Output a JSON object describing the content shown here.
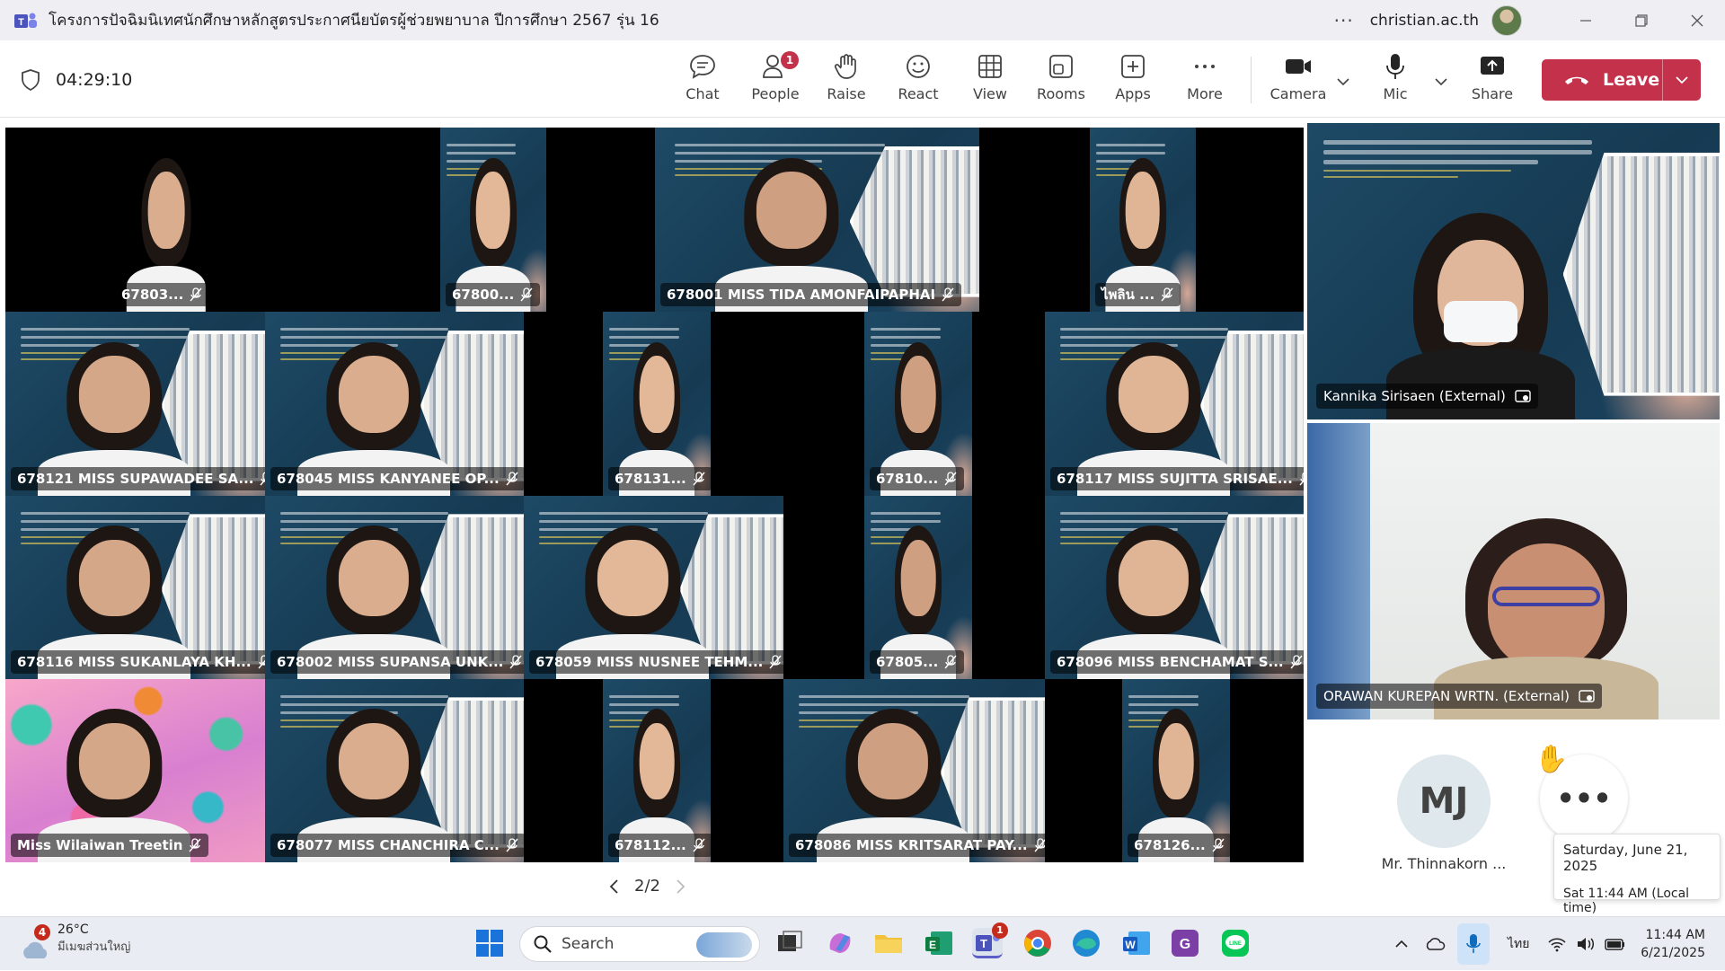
{
  "window": {
    "title": "โครงการปัจฉิมนิเทศนักศึกษาหลักสูตรประกาศนียบัตรผู้ช่วยพยาบาล ปีการศึกษา 2567 รุ่น 16",
    "account": "christian.ac.th",
    "more_glyph": "···"
  },
  "toolbar": {
    "timer": "04:29:10",
    "chat": "Chat",
    "people": "People",
    "people_badge": "1",
    "raise": "Raise",
    "react": "React",
    "view": "View",
    "rooms": "Rooms",
    "apps": "Apps",
    "more": "More",
    "camera": "Camera",
    "mic": "Mic",
    "share": "Share",
    "leave": "Leave"
  },
  "tiles": [
    {
      "name": "67803...",
      "bg": "dark"
    },
    {
      "name": "67800...",
      "bg": "slide"
    },
    {
      "name": "678001 MISS TIDA AMONFAIPAPHAI",
      "bg": "slide"
    },
    {
      "name": "ไพลิน ...",
      "bg": "slide"
    },
    {
      "name": "678121 MISS SUPAWADEE SA...",
      "bg": "slide"
    },
    {
      "name": "678045 MISS KANYANEE OP...",
      "bg": "slide"
    },
    {
      "name": "678131...",
      "bg": "slide"
    },
    {
      "name": "67810...",
      "bg": "slide"
    },
    {
      "name": "678117 MISS SUJITTA SRISAE...",
      "bg": "slide"
    },
    {
      "name": "678116 MISS SUKANLAYA KH...",
      "bg": "slide"
    },
    {
      "name": "678002 MISS SUPANSA UNK...",
      "bg": "slide"
    },
    {
      "name": "678059 MISS NUSNEE TEHM...",
      "bg": "slide"
    },
    {
      "name": "67805...",
      "bg": "slide"
    },
    {
      "name": "678096 MISS BENCHAMAT S...",
      "bg": "slide"
    },
    {
      "name": "Miss Wilaiwan Treetin",
      "bg": "pink"
    },
    {
      "name": "678077 MISS CHANCHIRA C...",
      "bg": "slide"
    },
    {
      "name": "678112...",
      "bg": "slide"
    },
    {
      "name": "678086 MISS KRITSARAT PAY...",
      "bg": "slide"
    },
    {
      "name": "678126...",
      "bg": "slide"
    }
  ],
  "pager": {
    "text": "2/2"
  },
  "right_panel": {
    "tile1_name": "Kannika Sirisaen (External)",
    "tile2_name": "ORAWAN KUREPAN WRTN. (External)",
    "initials": "MJ",
    "avatar_name": "Mr. Thinnakorn ...",
    "more_glyph": "•••",
    "tooltip_date": "Saturday, June 21, 2025",
    "tooltip_time": "Sat 11:44 AM (Local time)"
  },
  "taskbar": {
    "weather_badge": "4",
    "temp": "26°C",
    "condition": "มีเมฆส่วนใหญ่",
    "search": "Search",
    "teams_badge": "1",
    "lang": "ไทย",
    "time": "11:44 AM",
    "date": "6/21/2025"
  },
  "colors": {
    "leave": "#c4314b",
    "badge": "#c4314b",
    "stage_bg": "#000000",
    "slide_bg": "#1e4a66"
  }
}
